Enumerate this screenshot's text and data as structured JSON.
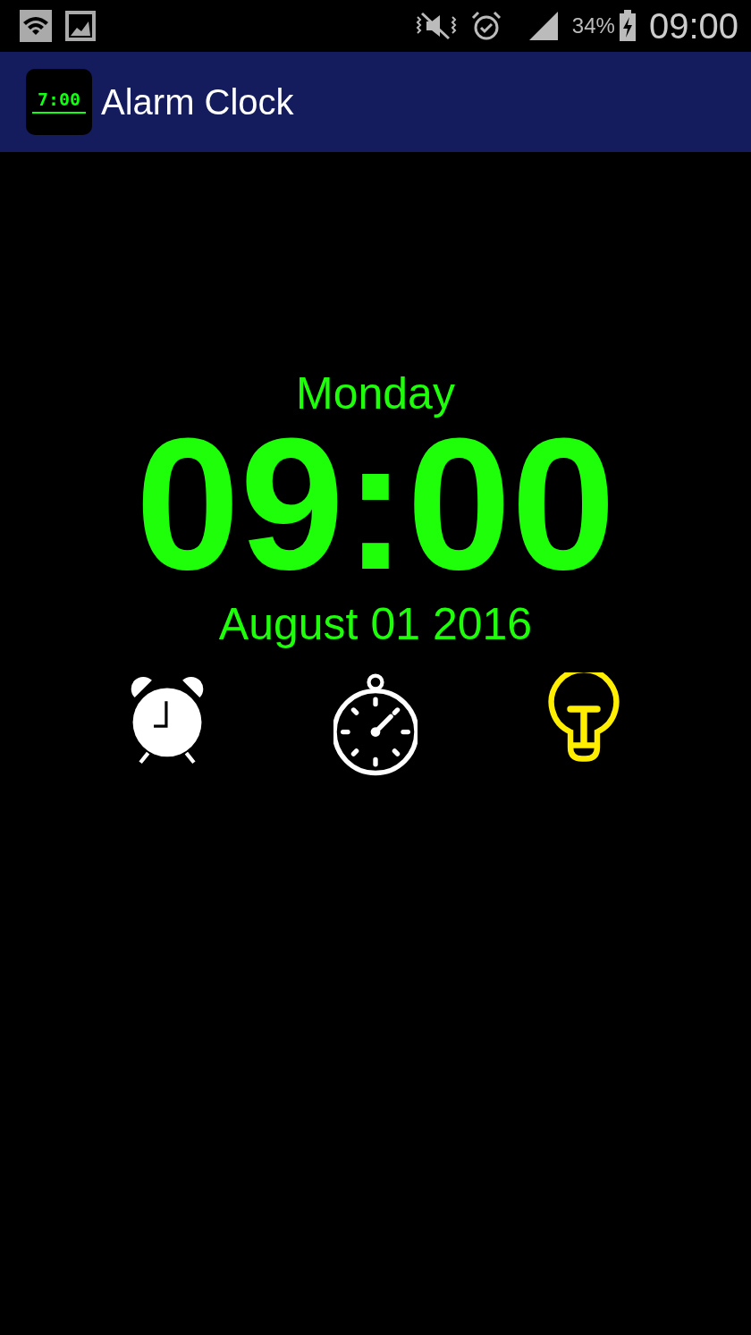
{
  "status_bar": {
    "battery": "34%",
    "time": "09:00"
  },
  "app_bar": {
    "icon_time": "7:00",
    "title": "Alarm Clock"
  },
  "clock": {
    "day": "Monday",
    "time": "09:00",
    "date": "August 01 2016"
  },
  "actions": [
    {
      "kind": "alarm",
      "on": false
    },
    {
      "kind": "stopwatch",
      "on": false
    },
    {
      "kind": "flashlight",
      "on": true
    }
  ]
}
